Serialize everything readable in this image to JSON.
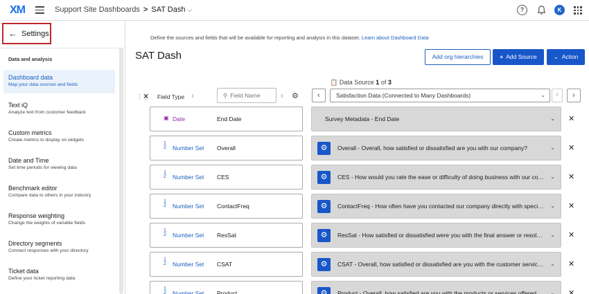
{
  "topbar": {
    "logo": "XM",
    "breadcrumb_parent": "Support Site Dashboards",
    "breadcrumb_sep": ">",
    "breadcrumb_current": "SAT Dash",
    "help_glyph": "?",
    "avatar_initial": "K"
  },
  "sidebar": {
    "settings_label": "Settings",
    "section_heading": "Data and analysis",
    "items": [
      {
        "title": "Dashboard data",
        "desc": "Map your data sources and fields",
        "active": true
      },
      {
        "title": "Text iQ",
        "desc": "Analyze text from customer feedback"
      },
      {
        "title": "Custom metrics",
        "desc": "Create metrics to display on widgets"
      },
      {
        "title": "Date and Time",
        "desc": "Set time periods for viewing data"
      },
      {
        "title": "Benchmark editor",
        "desc": "Compare data to others in your industry"
      },
      {
        "title": "Response weighting",
        "desc": "Change the weights of variable fields"
      },
      {
        "title": "Directory segments",
        "desc": "Connect responses with your directory"
      },
      {
        "title": "Ticket data",
        "desc": "Define your ticket reporting data"
      }
    ]
  },
  "main": {
    "intro_text": "Define the sources and fields that will be available for reporting and analysis in this dataset.",
    "intro_link": "Learn about Dashboard Data",
    "title": "SAT Dash",
    "buttons": {
      "org_hierarchies": "Add org hierarchies",
      "add_source": "Add Source",
      "action": "Action"
    },
    "columns": {
      "field_type": "Field Type",
      "field_name_placeholder": "Field Name"
    },
    "data_source": {
      "label": "Data Source",
      "current": "1",
      "of_word": "of",
      "total": "3",
      "selected": "Satisfaction Data (Connected to Many Dashboards)"
    },
    "rows": [
      {
        "type": "Date",
        "name": "End Date",
        "source": "Survey Metadata - End Date",
        "gear": false
      },
      {
        "type": "Number Set",
        "name": "Overall",
        "source": "Overall - Overall, how satisfied or dissatisfied are you with our company?",
        "gear": true
      },
      {
        "type": "Number Set",
        "name": "CES",
        "source": "CES - How would you rate the ease or difficulty of doing business with our company?",
        "gear": true
      },
      {
        "type": "Number Set",
        "name": "ContactFreq",
        "source": "ContactFreq - How often have you contacted our company directly with specific questions?",
        "gear": true
      },
      {
        "type": "Number Set",
        "name": "ResSat",
        "source": "ResSat - How satisfied or dissatisfied were you with the final answer or resolution to your issue?",
        "gear": true
      },
      {
        "type": "Number Set",
        "name": "CSAT",
        "source": "CSAT - Overall, how satisfied or dissatisfied are you with the customer service our company provides?",
        "gear": true
      },
      {
        "type": "Number Set",
        "name": "Product",
        "source": "Product - Overall, how satisfied are you with the products or services offered by our company?",
        "gear": true
      }
    ]
  }
}
